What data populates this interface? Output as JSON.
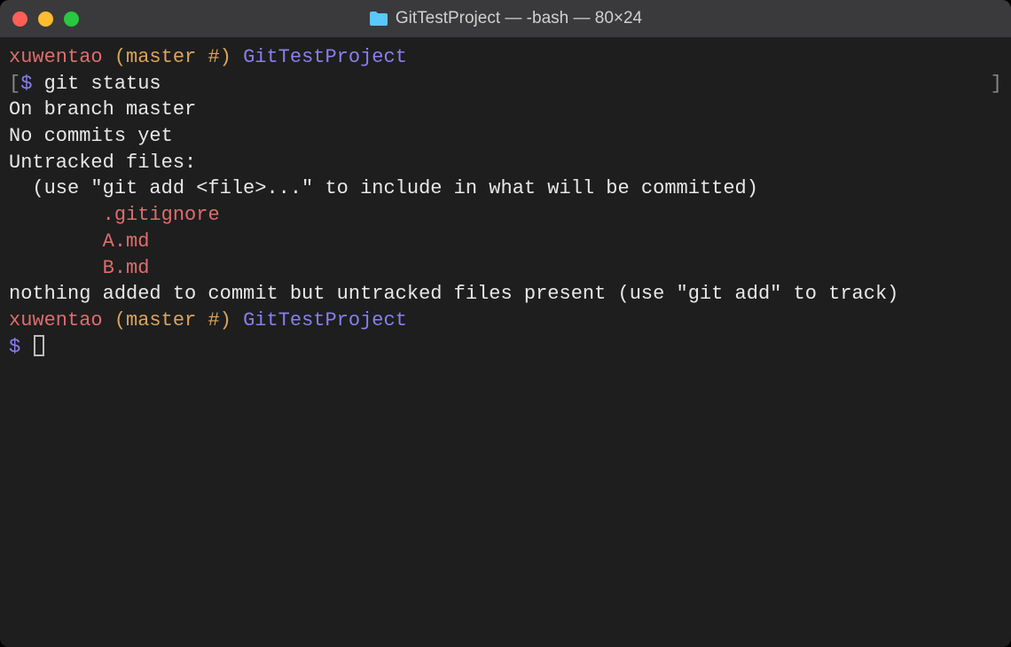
{
  "window": {
    "title": "GitTestProject — -bash — 80×24"
  },
  "prompt": {
    "user": "xuwentao",
    "branch_open": " (",
    "branch": "master #",
    "branch_close": ") ",
    "project": "GitTestProject",
    "dollar": "$ ",
    "bracket_open": "[",
    "bracket_close": "]"
  },
  "command": "git status",
  "output": {
    "on_branch": "On branch master",
    "blank": "",
    "no_commits": "No commits yet",
    "untracked_header": "Untracked files:",
    "untracked_hint": "  (use \"git add <file>...\" to include in what will be committed)",
    "files_indent": "        ",
    "files": [
      ".gitignore",
      "A.md",
      "B.md"
    ],
    "nothing_added": "nothing added to commit but untracked files present (use \"git add\" to track)"
  }
}
